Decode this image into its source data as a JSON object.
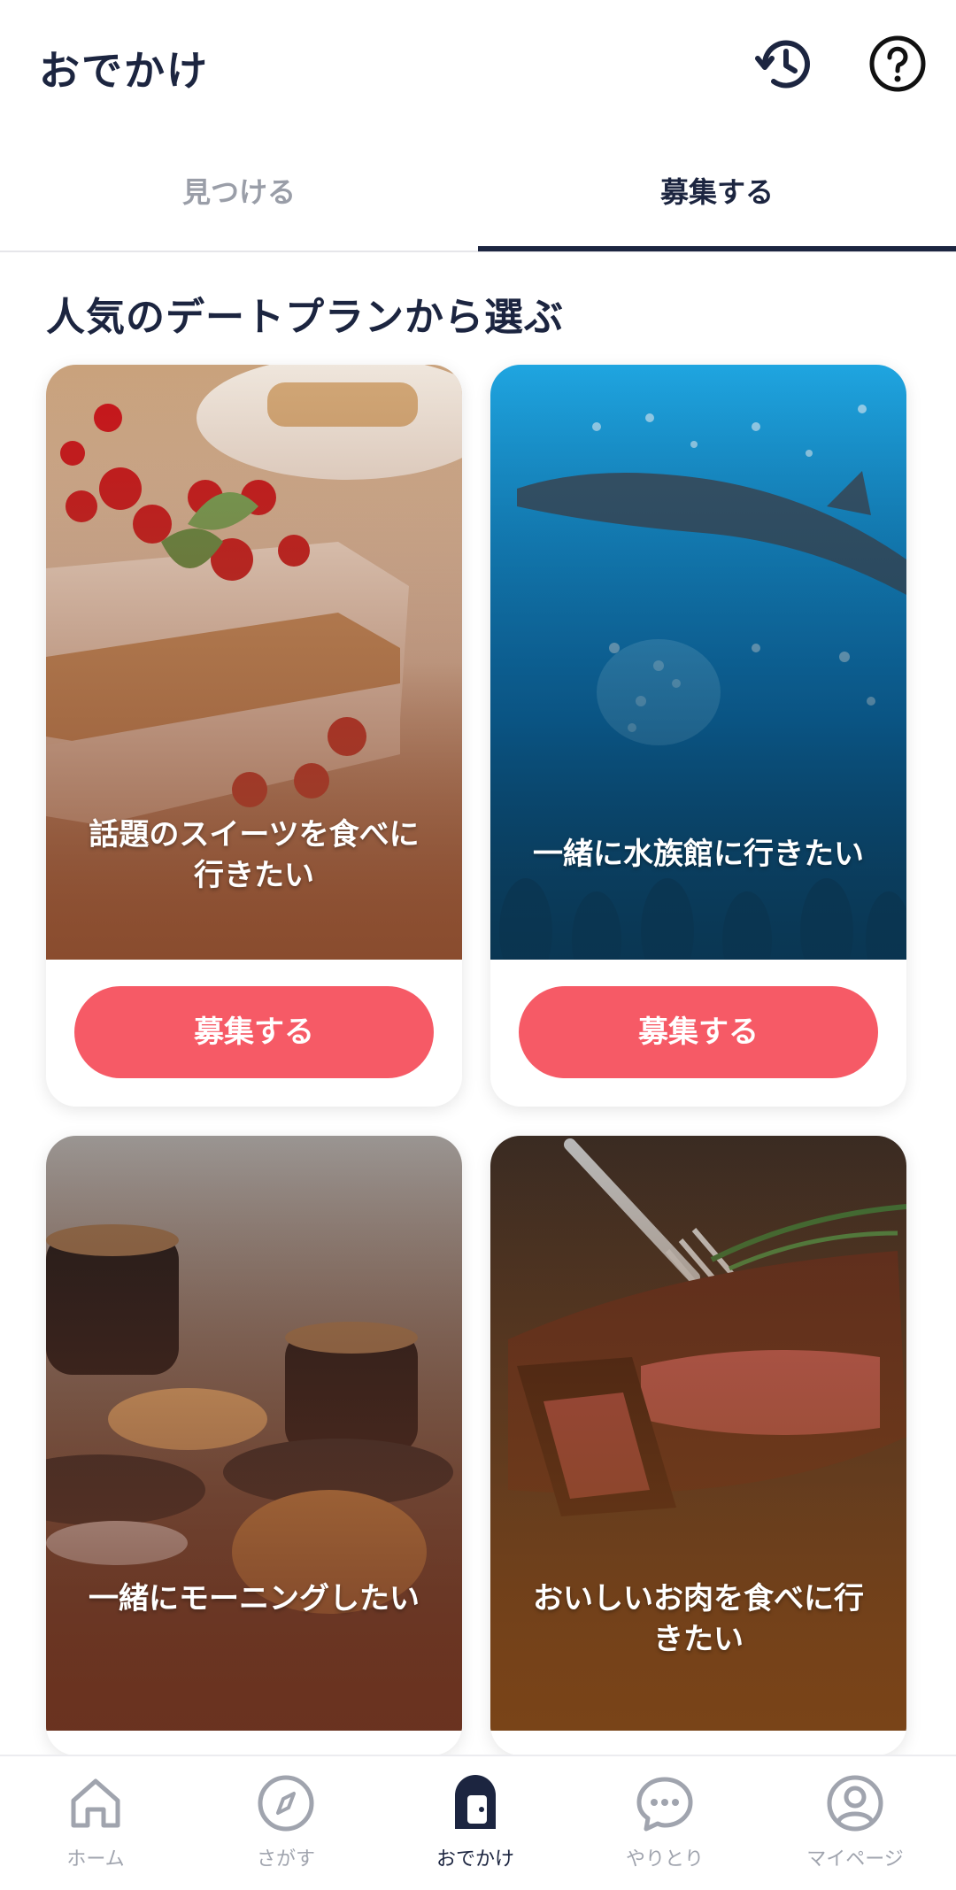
{
  "header": {
    "title": "おでかけ"
  },
  "tabs": [
    {
      "label": "見つける",
      "active": false
    },
    {
      "label": "募集する",
      "active": true
    }
  ],
  "section": {
    "title": "人気のデートプランから選ぶ"
  },
  "cards": [
    {
      "caption": "話題のスイーツを食べに\n行きたい",
      "button": "募集する",
      "image": "cake-photo"
    },
    {
      "caption": "一緒に水族館に行きたい",
      "button": "募集する",
      "image": "aquarium-photo"
    },
    {
      "caption": "一緒にモーニングしたい",
      "image": "coffee-photo"
    },
    {
      "caption": "おいしいお肉を食べに行\nきたい",
      "image": "steak-photo"
    }
  ],
  "bottom_nav": [
    {
      "label": "ホーム",
      "icon": "home-icon",
      "active": false
    },
    {
      "label": "さがす",
      "icon": "compass-icon",
      "active": false
    },
    {
      "label": "おでかけ",
      "icon": "door-icon",
      "active": true
    },
    {
      "label": "やりとり",
      "icon": "chat-icon",
      "active": false
    },
    {
      "label": "マイページ",
      "icon": "user-icon",
      "active": false
    }
  ],
  "colors": {
    "primary": "#1c2540",
    "accent": "#f65a66",
    "inactive": "#a0a4ae"
  }
}
